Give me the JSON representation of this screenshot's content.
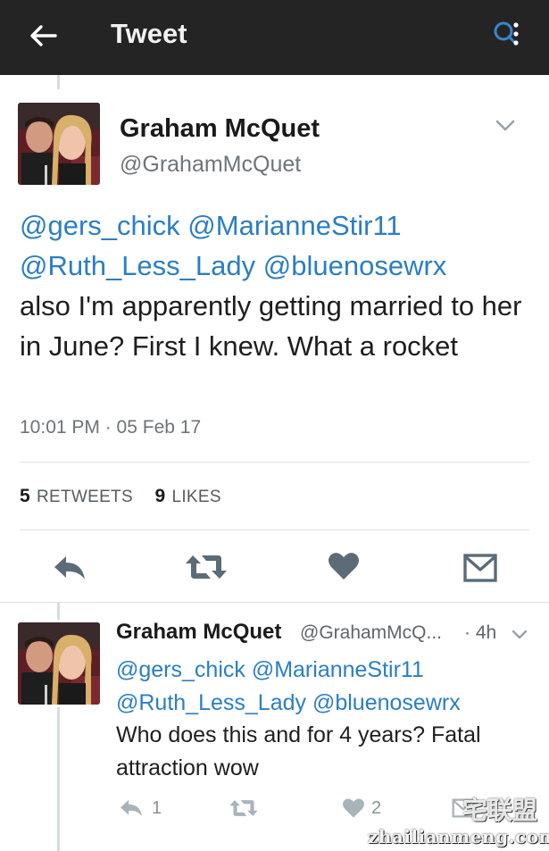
{
  "app_bar": {
    "title": "Tweet",
    "back_icon": "arrow-left-icon",
    "search_icon": "search-icon",
    "background": "#242424"
  },
  "main_tweet": {
    "author_name": "Graham McQuet",
    "author_handle": "@GrahamMcQuet",
    "mentions_line1": [
      "@gers_chick",
      "@MarianneStir11"
    ],
    "mentions_line2": [
      "@Ruth_Less_Lady",
      "@bluenosewrx"
    ],
    "text": "also I'm apparently getting married to her in June? First I knew. What a rocket",
    "timestamp": "10:01 PM · 05 Feb 17",
    "retweets_count": "5",
    "retweets_label": "RETWEETS",
    "likes_count": "9",
    "likes_label": "LIKES",
    "mention_color": "#2b7ec4"
  },
  "actions": {
    "reply_icon": "reply-icon",
    "retweet_icon": "retweet-icon",
    "like_icon": "heart-icon",
    "dm_icon": "envelope-icon"
  },
  "reply_tweet": {
    "author_name": "Graham McQuet",
    "author_handle": "@GrahamMcQ...",
    "time": "· 4h",
    "mentions_line1": [
      "@gers_chick",
      "@MarianneStir11"
    ],
    "mentions_line2": [
      "@Ruth_Less_Lady",
      "@bluenosewrx"
    ],
    "text": "Who does this and for 4 years? Fatal attraction wow",
    "reply_count": "1",
    "like_count": "2"
  },
  "watermark": {
    "cn": "宅联盟",
    "en": "zhailianmeng.com"
  }
}
